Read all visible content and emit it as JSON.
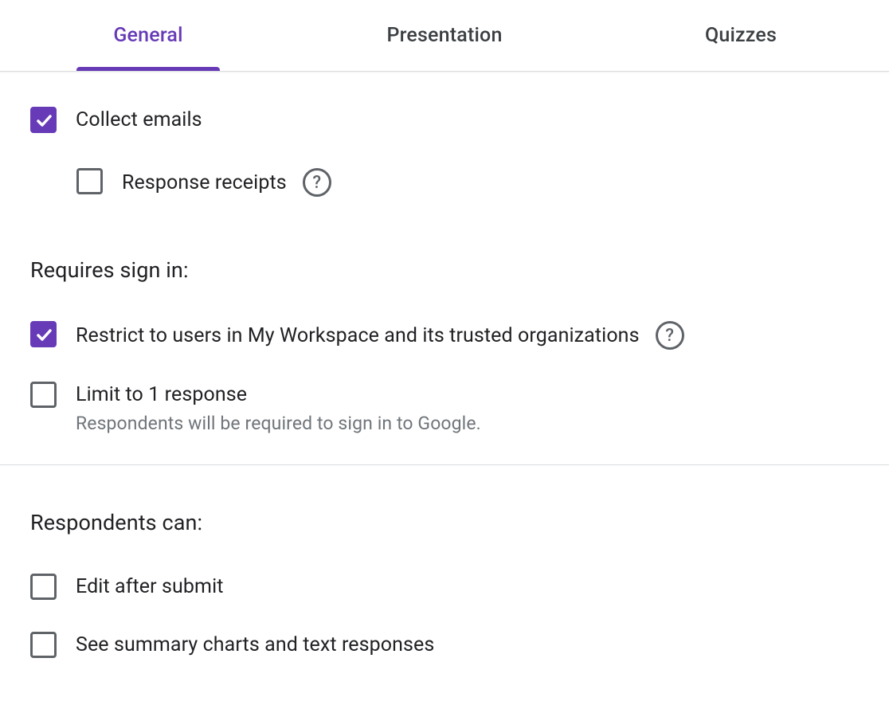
{
  "tabs": {
    "general": "General",
    "presentation": "Presentation",
    "quizzes": "Quizzes"
  },
  "general": {
    "collect_emails": "Collect emails",
    "response_receipts": "Response receipts",
    "requires_sign_in_title": "Requires sign in:",
    "restrict_users": "Restrict to users in My Workspace and its trusted organizations",
    "limit_response": "Limit to 1 response",
    "limit_response_sub": "Respondents will be required to sign in to Google.",
    "respondents_can_title": "Respondents can:",
    "edit_after_submit": "Edit after submit",
    "see_summary": "See summary charts and text responses"
  }
}
